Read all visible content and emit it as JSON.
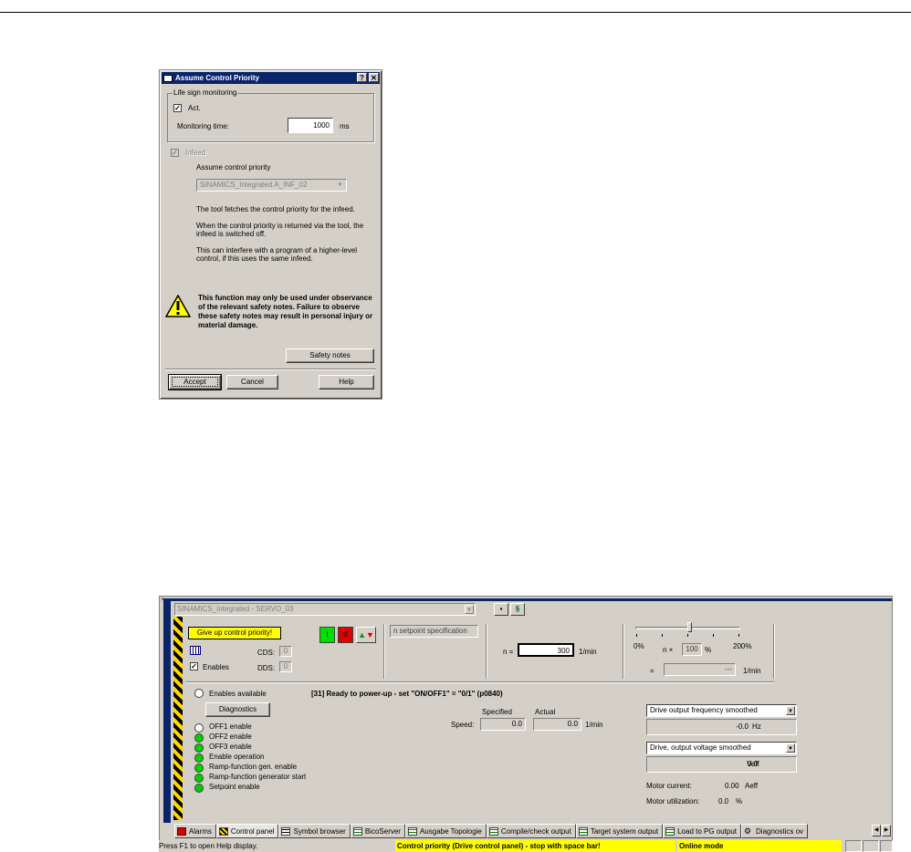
{
  "dialog": {
    "title": "Assume Control Priority",
    "help_btn": "?",
    "close_btn": "✕",
    "group_title": "Life sign monitoring",
    "act_label": "Act.",
    "act_checked": true,
    "monitoring_label": "Monitoring time:",
    "monitoring_value": "1000",
    "monitoring_unit": "ms",
    "infeed_label": "Infeed",
    "infeed_checked": true,
    "assume_label": "Assume control priority",
    "infeed_combo": "SINAMICS_Integrated.A_INF_02",
    "para1": "The tool fetches the control priority for the infeed.",
    "para2": "When the control priority is returned via the tool, the infeed is switched off.",
    "para3": "This can interfere with a program of a higher-level control, if this uses the same infeed.",
    "warning": "This function may only be used under observance of the relevant safety notes. Failure to observe these safety notes may result in personal injury or material damage.",
    "safety_btn": "Safety notes",
    "accept_btn": "Accept",
    "cancel_btn": "Cancel",
    "help_btn2": "Help"
  },
  "panel": {
    "close": "×",
    "drive": "SINAMICS_Integrated - SERVO_03",
    "give_up": "Give up control priority!",
    "on_label": "I",
    "off_label": "0",
    "cds_label": "CDS:",
    "cds_value": "0",
    "dds_label": "DDS:",
    "dds_value": "0",
    "enables_label": "Enables",
    "setpoint_spec": "n setpoint specification",
    "n_label": "n =",
    "n_value": "300",
    "n_unit": "1/min",
    "pct_min": "0%",
    "pct_max": "200%",
    "n_x": "n ×",
    "n_x_value": "100",
    "n_x_unit": "%",
    "dash": "=",
    "rpm_value": "---",
    "rpm_unit": "1/min",
    "enables_available": "Enables available",
    "status_msg": "[31] Ready to power-up - set \"ON/OFF1\" = \"0/1\" (p0840)",
    "diagnostics_btn": "Diagnostics",
    "specified_label": "Specified",
    "actual_label": "Actual",
    "speed_label": "Speed:",
    "speed_specified": "0.0",
    "speed_actual": "0.0",
    "speed_unit": "1/min",
    "freq_combo": "Drive output frequency smoothed",
    "freq_value": "-0.0",
    "freq_unit": "Hz",
    "volt_combo": "Drive, output voltage smoothed",
    "volt_value": "0.0",
    "volt_unit": "Veff",
    "motor_current_label": "Motor current:",
    "motor_current_value": "0.00",
    "motor_current_unit": "Aeff",
    "motor_util_label": "Motor utilization:",
    "motor_util_value": "0.0",
    "motor_util_unit": "%",
    "enable_rows": [
      {
        "label": "OFF1 enable",
        "color": "#ffffff"
      },
      {
        "label": "OFF2 enable",
        "color": "#00d000"
      },
      {
        "label": "OFF3 enable",
        "color": "#00d000"
      },
      {
        "label": "Enable operation",
        "color": "#00d000"
      },
      {
        "label": "Ramp-function gen. enable",
        "color": "#00d000"
      },
      {
        "label": "Ramp-function generator start",
        "color": "#00d000"
      },
      {
        "label": "Setpoint enable",
        "color": "#00d000"
      }
    ],
    "tabs": [
      {
        "label": "Alarms",
        "icon": "alarm"
      },
      {
        "label": "Control panel",
        "icon": "cp"
      },
      {
        "label": "Symbol browser",
        "icon": "sym"
      },
      {
        "label": "BicoServer",
        "icon": "grid"
      },
      {
        "label": "Ausgabe Topologie",
        "icon": "grid"
      },
      {
        "label": "Compile/check output",
        "icon": "grid"
      },
      {
        "label": "Target system output",
        "icon": "grid"
      },
      {
        "label": "Load to PG output",
        "icon": "grid"
      },
      {
        "label": "Diagnostics ov",
        "icon": "diag"
      }
    ]
  },
  "statusbar": {
    "help": "Press F1 to open Help display.",
    "control_priority": "Control priority (Drive control panel) - stop with space bar!",
    "online": "Online mode"
  }
}
